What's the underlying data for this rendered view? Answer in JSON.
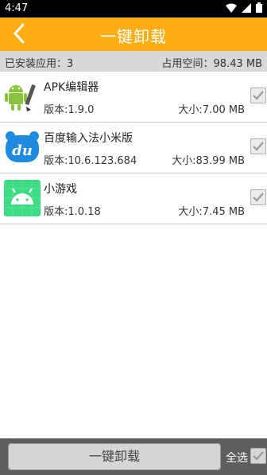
{
  "status": {
    "time": "4:47"
  },
  "header": {
    "title": "一键卸载"
  },
  "summary": {
    "installed": "已安装应用：3",
    "storage": "占用空间：98.43 MB"
  },
  "apps": [
    {
      "name": "APK编辑器",
      "version": "版本:1.9.0",
      "size": "大小:7.00 MB",
      "icon": "android-apk-editor-icon"
    },
    {
      "name": "百度输入法小米版",
      "version": "版本:10.6.123.684",
      "size": "大小:83.99 MB",
      "icon": "du-baidu-icon"
    },
    {
      "name": "小游戏",
      "version": "版本:1.0.18",
      "size": "大小:7.45 MB",
      "icon": "android-game-icon"
    }
  ],
  "footer": {
    "uninstall_label": "一键卸载",
    "select_all_label": "全选"
  },
  "colors": {
    "accent": "#ffad14",
    "du_blue": "#1e8be0",
    "android_green": "#3ddc84"
  }
}
